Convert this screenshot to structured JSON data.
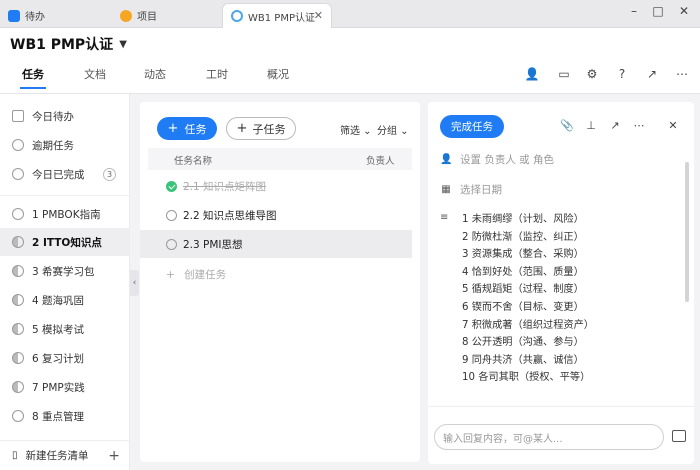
{
  "browser_tabs": [
    {
      "label": "待办",
      "icon": "todo-check-icon",
      "color": "#1f7cf5"
    },
    {
      "label": "项目",
      "icon": "project-icon",
      "color": "#f5a623"
    },
    {
      "label": "WB1 PMP认证",
      "icon": "project-circle-icon",
      "color": "#4aa8e8",
      "active": true
    }
  ],
  "window_controls": {
    "minimize": "–",
    "maximize": "□",
    "close": "✕"
  },
  "project": {
    "title": "WB1 PMP认证"
  },
  "nav_tabs": [
    "任务",
    "文档",
    "动态",
    "工时",
    "概况"
  ],
  "sidebar": {
    "quick": [
      {
        "label": "今日待办"
      },
      {
        "label": "逾期任务"
      },
      {
        "label": "今日已完成",
        "badge": "3"
      }
    ],
    "lists": [
      {
        "label": "1 PMBOK指南"
      },
      {
        "label": "2 ITTO知识点",
        "selected": true
      },
      {
        "label": "3 希赛学习包"
      },
      {
        "label": "4 题海巩固"
      },
      {
        "label": "5 模拟考试"
      },
      {
        "label": "6 复习计划"
      },
      {
        "label": "7 PMP实践"
      },
      {
        "label": "8 重点管理"
      }
    ],
    "footer": "新建任务清单"
  },
  "tasklist": {
    "add_button": "任务",
    "sub_button": "子任务",
    "filter": "筛选",
    "group": "分组",
    "col_name": "任务名称",
    "col_owner": "负责人",
    "rows": [
      {
        "label": "2.1 知识点矩阵图",
        "done": true
      },
      {
        "label": "2.2 知识点思维导图",
        "done": false
      },
      {
        "label": "2.3 PMI思想",
        "done": false,
        "selected": true
      }
    ],
    "new_task": "创建任务"
  },
  "detail": {
    "complete_button": "完成任务",
    "assignee": "设置 负责人 或 角色",
    "date": "选择日期",
    "description": [
      "1  未雨绸缪（计划、风险）",
      "2  防微杜渐（监控、纠正）",
      "3  资源集成（整合、采购）",
      "4  恰到好处（范围、质量）",
      "5  循规蹈矩（过程、制度）",
      "6  锲而不舍（目标、变更）",
      "7  积微成著（组织过程资产）",
      "8  公开透明（沟通、参与）",
      "9  同舟共济（共赢、诚信）",
      "10 各司其职（授权、平等）"
    ],
    "reply_placeholder": "输入回复内容，可@某人..."
  },
  "colors": {
    "accent": "#1f7cf5",
    "done_green": "#3ac37a"
  }
}
